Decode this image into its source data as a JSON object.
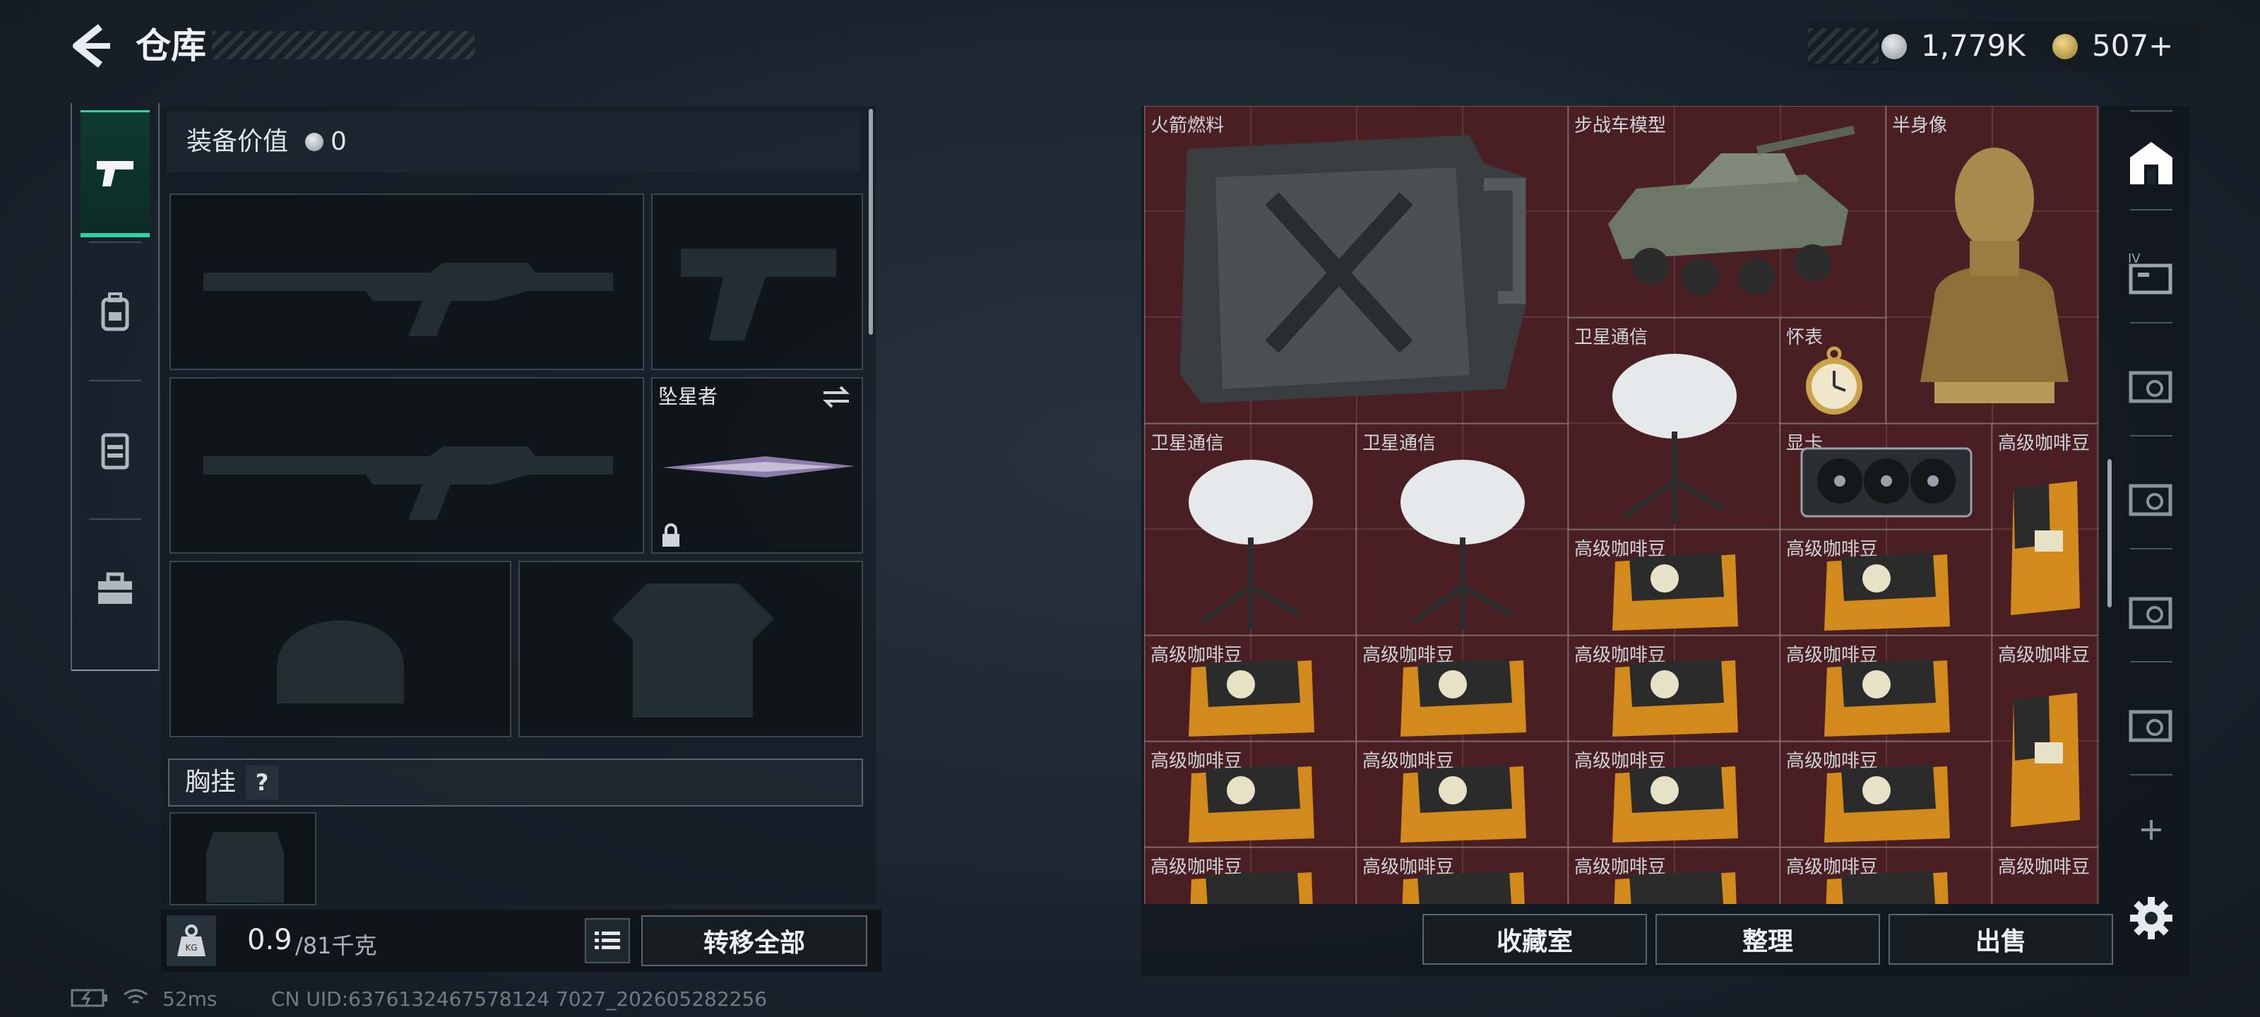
{
  "header": {
    "title": "仓库"
  },
  "currency": [
    {
      "amount": "1,779K",
      "icon": "silver-coin-icon",
      "color": "#b8c0c6"
    },
    {
      "amount": "507+",
      "icon": "gold-triangle-coin-icon",
      "color": "#c9a24a"
    }
  ],
  "left_tabs": [
    {
      "icon": "pistol-icon",
      "active": true
    },
    {
      "icon": "backpack-icon",
      "active": false
    },
    {
      "icon": "vest-icon",
      "active": false
    },
    {
      "icon": "toolbox-icon",
      "active": false
    }
  ],
  "equipment": {
    "value_label": "装备价值",
    "value": "0",
    "melee_label": "坠星者",
    "chest_label": "胸挂",
    "chest_help": "?"
  },
  "capacity": {
    "current": "0.9",
    "max": "/81千克"
  },
  "buttons": {
    "transfer_all": "转移全部",
    "collection": "收藏室",
    "organize": "整理",
    "sell": "出售"
  },
  "warehouse_items": [
    "火箭燃料",
    "步战车模型",
    "半身像",
    "卫星通信",
    "怀表",
    "卫星通信",
    "卫星通信",
    "显卡",
    "高级咖啡豆",
    "高级咖啡豆",
    "高级咖啡豆",
    "高级咖啡豆",
    "高级咖啡豆",
    "高级咖啡豆",
    "高级咖啡豆",
    "高级咖啡豆",
    "高级咖啡豆",
    "高级咖啡豆",
    "高级咖啡豆",
    "高级咖啡豆",
    "高级咖啡豆",
    "高级咖啡豆",
    "高级咖啡豆",
    "高级咖啡豆",
    "高级咖啡豆"
  ],
  "right_tabs": [
    {
      "icon": "stash-home-icon",
      "active": true
    },
    {
      "icon": "storage-box-icon-4"
    },
    {
      "icon": "storage-box-icon"
    },
    {
      "icon": "storage-box-icon"
    },
    {
      "icon": "storage-box-icon"
    },
    {
      "icon": "storage-box-icon"
    }
  ],
  "status": {
    "ping": "52ms",
    "uid": "CN UID:6376132467578124 7027_202605282256"
  }
}
